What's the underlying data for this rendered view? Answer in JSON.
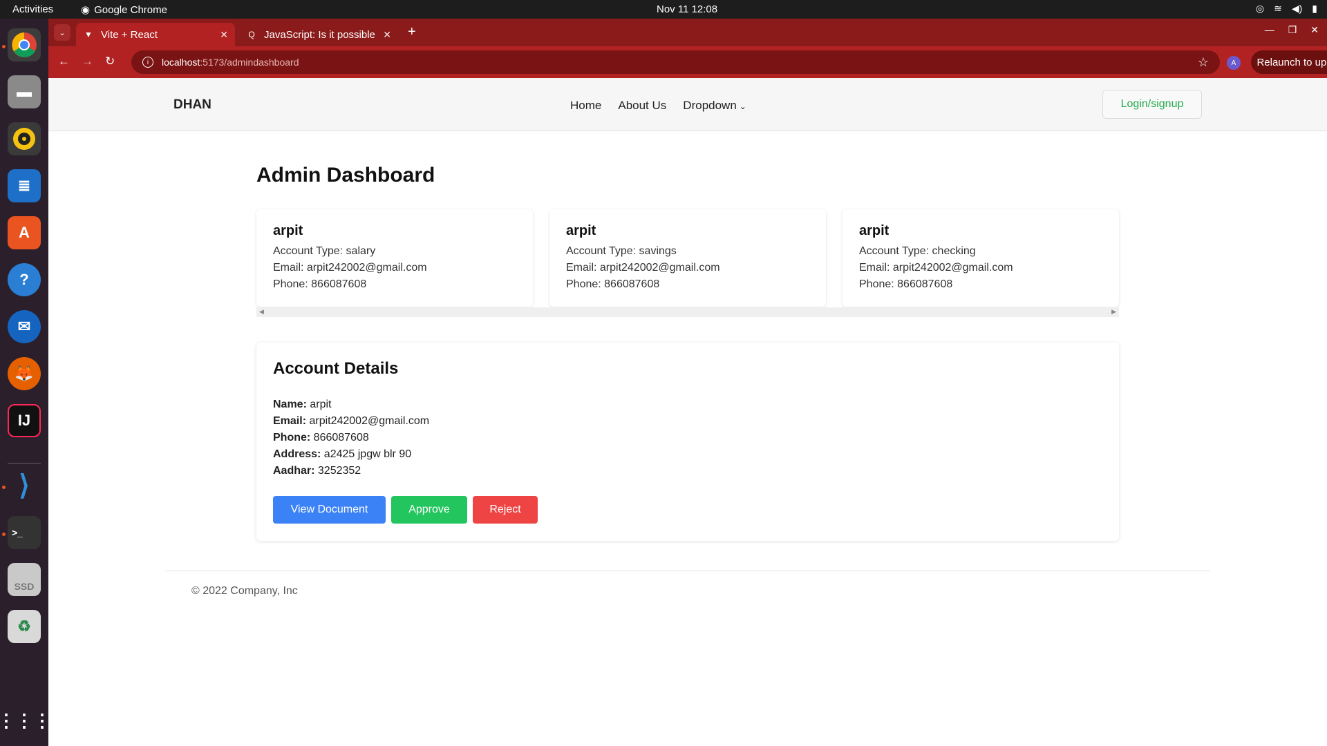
{
  "system": {
    "activities": "Activities",
    "app_name": "Google Chrome",
    "clock": "Nov 11  12:08"
  },
  "dock": {
    "items": [
      "chrome-icon",
      "files-icon",
      "rhythmbox-icon",
      "writer-icon",
      "app-center-icon",
      "help-icon",
      "thunderbird-icon",
      "firefox-icon",
      "intellij-icon",
      "vscode-icon",
      "terminal-icon",
      "ssd-drive-icon",
      "trash-icon",
      "app-grid-icon"
    ],
    "ssd_label": "SSD"
  },
  "browser": {
    "tabs": [
      {
        "title": "Vite + React",
        "active": true
      },
      {
        "title": "JavaScript: Is it possible",
        "active": false
      }
    ],
    "url_host": "localhost",
    "url_path": ":5173/admindashboard",
    "profile_initial": "A",
    "relaunch_label": "Relaunch to update"
  },
  "navbar": {
    "brand": "DHAN",
    "links": [
      "Home",
      "About Us",
      "Dropdown"
    ],
    "login_label": "Login/signup"
  },
  "page_title": "Admin Dashboard",
  "accounts": [
    {
      "name": "arpit",
      "type": "Account Type: salary",
      "email": "Email: arpit242002@gmail.com",
      "phone": "Phone: 866087608"
    },
    {
      "name": "arpit",
      "type": "Account Type: savings",
      "email": "Email: arpit242002@gmail.com",
      "phone": "Phone: 866087608"
    },
    {
      "name": "arpit",
      "type": "Account Type: checking",
      "email": "Email: arpit242002@gmail.com",
      "phone": "Phone: 866087608"
    }
  ],
  "details": {
    "title": "Account Details",
    "fields": [
      {
        "label": "Name:",
        "value": " arpit"
      },
      {
        "label": "Email:",
        "value": " arpit242002@gmail.com"
      },
      {
        "label": "Phone:",
        "value": " 866087608"
      },
      {
        "label": "Address:",
        "value": " a2425 jpgw blr 90"
      },
      {
        "label": "Aadhar:",
        "value": " 3252352"
      }
    ],
    "buttons": {
      "view": "View Document",
      "approve": "Approve",
      "reject": "Reject"
    }
  },
  "footer": "© 2022 Company, Inc",
  "colors": {
    "chrome_tabstrip": "#8b1a1a",
    "chrome_toolbar": "#b22222",
    "login_text": "#22a94a",
    "view_button": "#3b82f6",
    "approve_button": "#22c55e",
    "reject_button": "#ef4444"
  }
}
